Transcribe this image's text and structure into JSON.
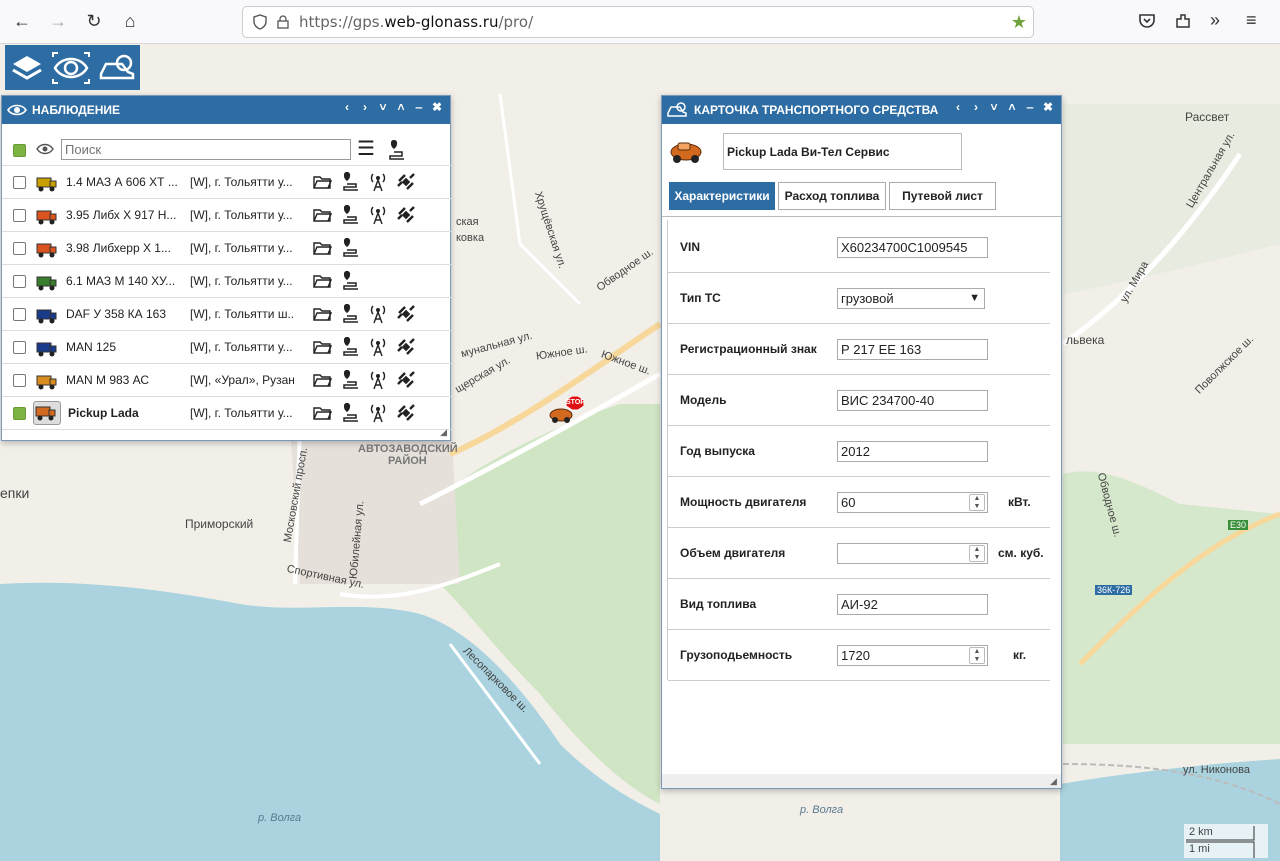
{
  "browser": {
    "url_scheme": "https://gps.",
    "url_host": "web-glonass.ru",
    "url_path": "/pro/"
  },
  "map_labels": {
    "rassvet": "Рассвет",
    "hrushchevskaya": "Хрущёвская ул.",
    "obvodnoe1": "Обводное ш.",
    "yuzhnoe1": "Южное ш.",
    "yuzhnoe2": "Южное ш.",
    "avtozavod1": "АВТОЗАВОДСКИЙ",
    "avtozavod2": "РАЙОН",
    "primorsky": "Приморский",
    "moskovsky": "Московский просп.",
    "sportivnaya": "Спортивная ул.",
    "yubileinaya": "Юбилейная ул.",
    "lesoparkovoe": "Лесопарковое ш.",
    "volga1": "р. Волга",
    "volga2": "р. Волга",
    "tsentralnaya": "Центральная ул.",
    "mira": "ул. Мира",
    "povolzhskoe": "Поволжское ш.",
    "obvodnoe2": "Обводное ш.",
    "nikonova": "ул. Никонова",
    "ska": "ская",
    "kova": "ковка",
    "lka": "львека",
    "epki": "епки",
    "sporaya": "щерская ул.",
    "munalnaya": "мунальная ул.",
    "e30": "E30",
    "r726": "36К-726",
    "scale_km": "2 km",
    "scale_mi": "1 mi",
    "stop": "STOP"
  },
  "observe": {
    "title": "НАБЛЮДЕНИЕ",
    "search_placeholder": "Поиск",
    "controls": [
      "‹",
      "›",
      "˅",
      "˄",
      "‒",
      "✖"
    ],
    "vehicles": [
      {
        "name": "1.4 МАЗ А 606 ХТ ...",
        "addr": "[W], г. Тольятти у...",
        "checked": false,
        "icons": 4
      },
      {
        "name": "3.95 Либх Х 917 Н...",
        "addr": "[W], г. Тольятти у...",
        "checked": false,
        "icons": 4
      },
      {
        "name": "3.98 Либхерр Х 1...",
        "addr": "[W], г. Тольятти у...",
        "checked": false,
        "icons": 2
      },
      {
        "name": "6.1 МАЗ М 140 ХУ...",
        "addr": "[W], г. Тольятти у...",
        "checked": false,
        "icons": 2
      },
      {
        "name": "DAF У 358 КА 163",
        "addr": "[W], г. Тольятти ш...",
        "checked": false,
        "icons": 4
      },
      {
        "name": "MAN 125",
        "addr": "[W], г. Тольятти у...",
        "checked": false,
        "icons": 4
      },
      {
        "name": "MAN М 983 АС",
        "addr": "[W], «Урал», Рузан...",
        "checked": false,
        "icons": 4
      },
      {
        "name": "Pickup Lada",
        "addr": "[W], г. Тольятти у...",
        "checked": true,
        "icons": 4
      }
    ]
  },
  "card": {
    "title": "КАРТОЧКА ТРАНСПОРТНОГО СРЕДСТВА",
    "vehicle_name": "Pickup Lada Ви-Тел Сервис",
    "tabs": [
      "Характеристики",
      "Расход топлива",
      "Путевой лист"
    ],
    "fields": [
      {
        "label": "VIN",
        "value": "X60234700C1009545",
        "type": "text"
      },
      {
        "label": "Тип ТС",
        "value": "грузовой",
        "type": "select"
      },
      {
        "label": "Регистрационный знак",
        "value": "Р 217 ЕЕ 163",
        "type": "text"
      },
      {
        "label": "Модель",
        "value": "ВИС 234700-40",
        "type": "text"
      },
      {
        "label": "Год выпуска",
        "value": "2012",
        "type": "text"
      },
      {
        "label": "Мощность двигателя",
        "value": "60",
        "type": "number",
        "unit": "кВт."
      },
      {
        "label": "Объем двигателя",
        "value": "",
        "type": "number",
        "unit": "см. куб."
      },
      {
        "label": "Вид топлива",
        "value": "АИ-92",
        "type": "text"
      },
      {
        "label": "Грузоподьемность",
        "value": "1720",
        "type": "number",
        "unit": "кг."
      }
    ]
  }
}
